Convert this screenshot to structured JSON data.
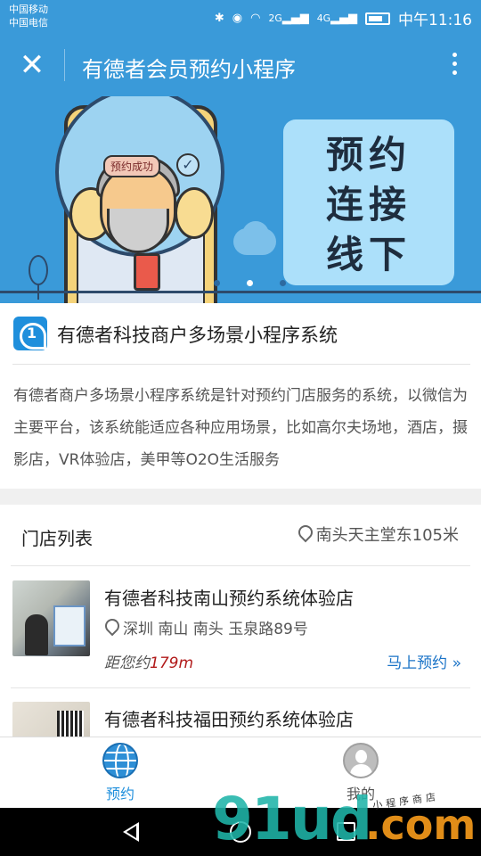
{
  "status_bar": {
    "carrier_1": "中国移动",
    "carrier_2": "中国电信",
    "signal_1": "2G",
    "signal_2": "4G",
    "time": "中午11:16"
  },
  "title_bar": {
    "close_glyph": "✕",
    "title": "有德者会员预约小程序"
  },
  "banner": {
    "success_tag": "预约成功",
    "check_glyph": "✓",
    "board_lines": [
      "预约",
      "连接",
      "线下"
    ]
  },
  "intro": {
    "brand_name": "有德者科技商户多场景小程序系统",
    "description": "有德者商户多场景小程序系统是针对预约门店服务的系统，以微信为主要平台，该系统能适应各种应用场景，比如高尔夫场地，酒店，摄影店，VR体验店，美甲等O2O生活服务"
  },
  "store_list": {
    "title": "门店列表",
    "current_location": "南头天主堂东105米",
    "stores": [
      {
        "name": "有德者科技南山预约系统体验店",
        "address": "深圳 南山 南头 玉泉路89号",
        "distance_prefix": "距您约",
        "distance_value": "179m",
        "book_label": "马上预约 »"
      },
      {
        "name": "有德者科技福田预约系统体验店"
      }
    ]
  },
  "tab_bar": {
    "tabs": [
      {
        "label": "预约",
        "icon": "globe-icon",
        "active": true
      },
      {
        "label": "我的",
        "icon": "person-icon",
        "active": false
      }
    ]
  },
  "watermark": {
    "logo_text": "91ud",
    "dot_com": ".com",
    "tagline": "小程序商店"
  },
  "colors": {
    "header_blue": "#3a9ad9",
    "active_tab": "#1f8fdc",
    "distance_red": "#b21b1b",
    "link_blue": "#1a73c7"
  }
}
